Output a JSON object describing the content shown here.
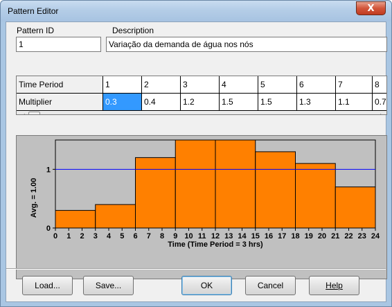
{
  "window": {
    "title": "Pattern Editor",
    "close_label": "X"
  },
  "pattern_id": {
    "label": "Pattern ID",
    "value": "1"
  },
  "description": {
    "label": "Description",
    "value": "Variação da demanda de água nos nós"
  },
  "grid": {
    "row_headers": [
      "Time Period",
      "Multiplier"
    ],
    "periods": [
      "1",
      "2",
      "3",
      "4",
      "5",
      "6",
      "7",
      "8"
    ],
    "multipliers": [
      "0.3",
      "0.4",
      "1.2",
      "1.5",
      "1.5",
      "1.3",
      "1.1",
      "0.7"
    ],
    "selected_index": 0
  },
  "chart_data": {
    "type": "bar",
    "x": [
      0,
      3,
      6,
      9,
      12,
      15,
      18,
      21,
      24
    ],
    "values": [
      0.3,
      0.4,
      1.2,
      1.5,
      1.5,
      1.3,
      1.1,
      0.7
    ],
    "xticks": [
      0,
      1,
      2,
      3,
      4,
      5,
      6,
      7,
      8,
      9,
      10,
      11,
      12,
      13,
      14,
      15,
      16,
      17,
      18,
      19,
      20,
      21,
      22,
      23,
      24
    ],
    "yticks": [
      0,
      1
    ],
    "xlim": [
      0,
      24
    ],
    "ylim": [
      0,
      1.5
    ],
    "average": 1.0,
    "xlabel": "Time (Time Period = 3 hrs)",
    "ylabel": "Avg. = 1.00",
    "bar_color": "#ff8000",
    "average_line_color": "#0000ff",
    "background_color": "#c0c0c0"
  },
  "buttons": {
    "load": "Load...",
    "save": "Save...",
    "ok": "OK",
    "cancel": "Cancel",
    "help": "Help"
  }
}
